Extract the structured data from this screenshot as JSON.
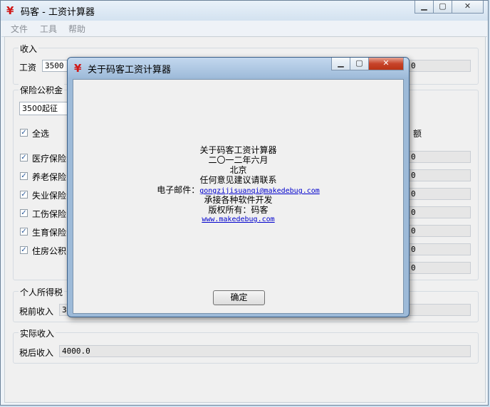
{
  "window": {
    "title": "码客 - 工资计算器",
    "icon": "¥"
  },
  "menu": [
    "文件",
    "工具",
    "帮助"
  ],
  "income": {
    "group_title": "收入",
    "salary_label": "工资",
    "salary_value": "3500"
  },
  "insurance": {
    "group_title": "保险公积金",
    "threshold_selected": "3500起征",
    "select_all_label": "全选",
    "amount_header_partial": "额",
    "items": [
      {
        "label": "医疗保险",
        "value": "0"
      },
      {
        "label": "养老保险",
        "value": "0"
      },
      {
        "label": "失业保险",
        "value": "0"
      },
      {
        "label": "工伤保险",
        "value": "0"
      },
      {
        "label": "生育保险",
        "value": "0"
      },
      {
        "label": "住房公积",
        "value": "0"
      },
      {
        "label": "",
        "value": "0"
      }
    ],
    "salary_right_value": "0"
  },
  "tax": {
    "group_title": "个人所得税",
    "pretax_label": "税前收入",
    "pretax_value_partial": "3"
  },
  "actual": {
    "group_title": "实际收入",
    "aftertax_label": "税后收入",
    "aftertax_value": "4000.0"
  },
  "dialog": {
    "title": "关于码客工资计算器",
    "icon": "¥",
    "line1": "关于码客工资计算器",
    "line2": "二〇一二年六月",
    "line3": "北京",
    "line4": "任何意见建议请联系",
    "email_label": "电子邮件：",
    "email": "gongzijisuanqi@makedebug.com",
    "line6": "承接各种软件开发",
    "line7": "版权所有：码客",
    "website": "www.makedebug.com",
    "ok_label": "确定"
  }
}
